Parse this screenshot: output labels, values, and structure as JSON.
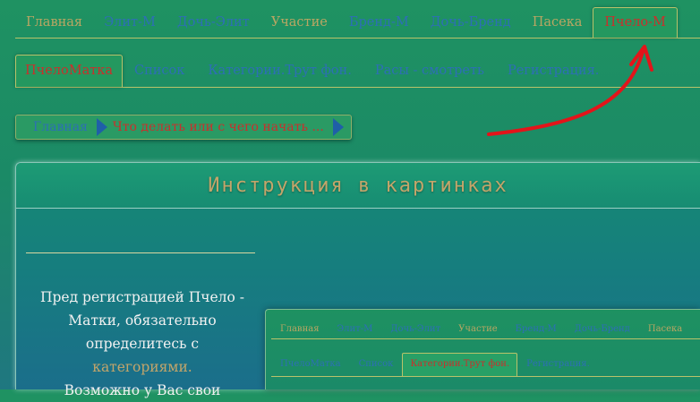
{
  "top_nav": {
    "items": [
      {
        "label": "Главная"
      },
      {
        "label": "Элит-М"
      },
      {
        "label": "Дочь-Элит"
      },
      {
        "label": "Участие"
      },
      {
        "label": "Бренд-М"
      },
      {
        "label": "Дочь-Бренд"
      },
      {
        "label": "Пасека"
      },
      {
        "label": "Пчело-М"
      }
    ],
    "active_index": 7
  },
  "sub_nav": {
    "items": [
      {
        "label": "ПчелоМатка"
      },
      {
        "label": "Список"
      },
      {
        "label": "Категории.Трут фон."
      },
      {
        "label": "Расы - смотреть"
      },
      {
        "label": "Регистрация."
      }
    ],
    "active_index": 0
  },
  "breadcrumb": {
    "home": "Главная",
    "current": "Что делать или с чего начать ..."
  },
  "panel": {
    "title": "Инструкция в картинках",
    "description_lines": [
      "Пред регистрацией Пчело -",
      "Матки, обязательно",
      "определитесь с",
      "категориями.",
      "Возможно у Вас свои"
    ]
  },
  "screenshot_preview": {
    "top_nav": [
      "Главная",
      "Элит-М",
      "Дочь-Элит",
      "Участие",
      "Бренд-М",
      "Дочь-Бренд",
      "Пасека"
    ],
    "sub_nav": [
      "ПчелоМатка",
      "Список",
      "Категории.Трут фон.",
      "Регистрация."
    ],
    "sub_active_index": 2
  },
  "colors": {
    "gold_text": "#b9a662",
    "link_blue": "#2d6fb5",
    "active_red": "#c9302c",
    "annotation_arrow": "#e3141a"
  }
}
